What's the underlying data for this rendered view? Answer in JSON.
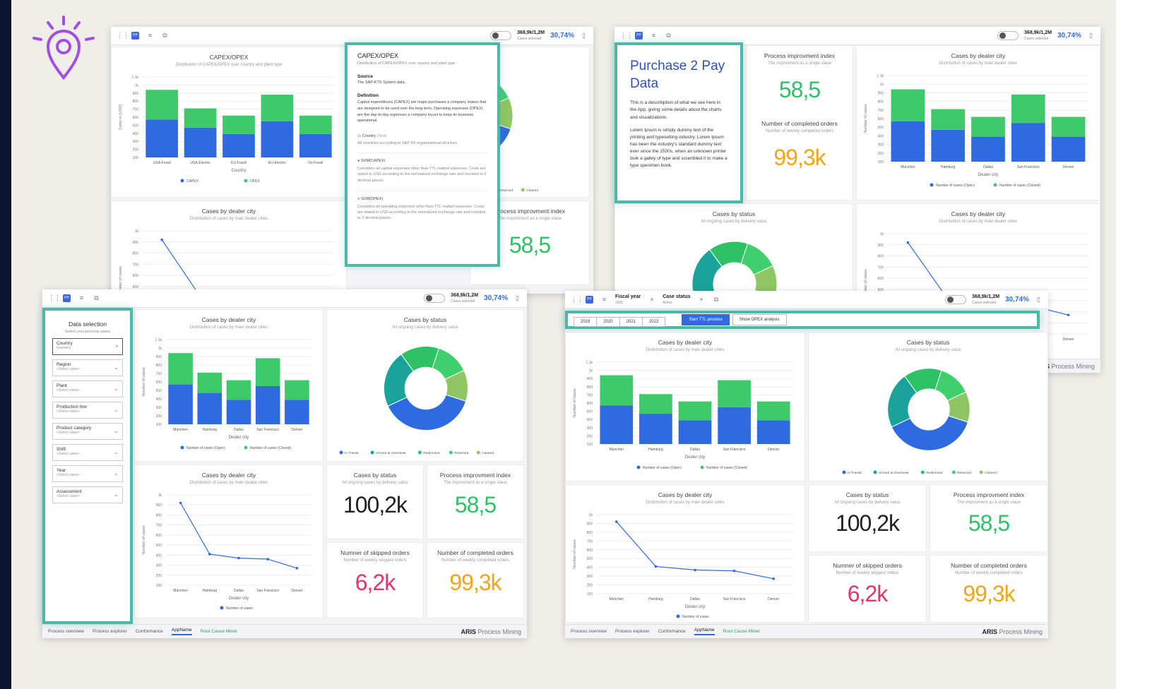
{
  "colors": {
    "blue": "#2f6be0",
    "green": "#3ec96a",
    "teal": "#4bb8a8",
    "orange": "#f2a517",
    "pink": "#e6336b"
  },
  "toolbar": {
    "kpi_value": "368,9k/1,2M",
    "kpi_label": "Cases selected",
    "pct": "30,74%",
    "fiscal_label": "Fiscal year",
    "fiscal_value": "2020",
    "status_label": "Case status",
    "status_value": "Active",
    "pp": "PP"
  },
  "capex": {
    "title": "CAPEX/OPEX",
    "subtitle": "Distribution of CAPEX/OPEX over country and plant type",
    "xlabel": "Country",
    "ylabel": "Costs in (USD)",
    "legend": [
      "CAPEX",
      "OPEX"
    ]
  },
  "tooltip": {
    "title": "CAPEX/OPEX",
    "subtitle": "Distribution of CAPEX/OPEX over country and plant type",
    "source_h": "Source",
    "source": "The SAP-KTS System data.",
    "def_h": "Definition",
    "def": "Capital expenditures (CAPEX) are major purchases a company makes that are designed to be used over the long term. Operating expenses (OPEX) are the day-to-day expenses a company incurs to keep its business operational.",
    "country_h": "Country",
    "country_tag": "(Text)",
    "country": "All countries according to SAP R3 organizational structure.",
    "capex_h": "SUM(CAPEX)",
    "capex": "Considers all capital expenses other than TTL realted expenses. Costs are stated in USD according to the normalized exchange rate and rounded to 2 decimal places.",
    "opex_h": "SUM(OPEX)",
    "opex": "Considers all operating expenses other than TTL realted expenses. Costs are stated in USD according to the normalized exchange rate and rounded to 2 decimal places."
  },
  "info": {
    "title": "Purchase 2 Pay Data",
    "p1": "This is a describption of what we see here in the App, giving some details about the charts and visualizations.",
    "p2": "Lorem Ipsum is simply dummy text of the printing and typesetting industry. Lorem Ipsum has been the industry's standard dummy text ever since the 1500s, when an unknown printer took a galley of type and scrambled it to make a type specimen book."
  },
  "cards": {
    "dealer_title": "Cases by dealer city",
    "dealer_sub": "Distribution of cases by main dealer cities",
    "dealer_x": "Dealer city",
    "dealer_y": "Number of cases",
    "legend_open": "Number of cases (Open)",
    "legend_closed": "Number of cases (Closed)",
    "legend_line": "Number of cases",
    "status_title": "Cases by status",
    "status_sub": "All ongoing cases by delivery satus",
    "status_legend": [
      "In Transit",
      "Arrived at Overseas",
      "Redirected",
      "Returned",
      "Cleared"
    ],
    "pii_title": "Process improvment index",
    "pii_sub": "The improvment as a single vlaue",
    "pii_val": "58,5",
    "cases_val": "100,2k",
    "skip_title": "Numner of skipped orders",
    "skip_sub": "Number of weekly skipped orders",
    "skip_val": "6,2k",
    "comp_title": "Number of completed orders",
    "comp_sub": "Number of weekly completed orders",
    "comp_val": "99,3k"
  },
  "filters": {
    "title": "Data selection",
    "subtitle": "Select your process cases",
    "items": [
      {
        "label": "Country",
        "value": "Germany"
      },
      {
        "label": "Region",
        "value": "<Select value>"
      },
      {
        "label": "Plant",
        "value": "<Select value>"
      },
      {
        "label": "Production line",
        "value": "<Select value>"
      },
      {
        "label": "Product category",
        "value": "<Select value>"
      },
      {
        "label": "Shift",
        "value": "<Select value>"
      },
      {
        "label": "Year",
        "value": "<Select value>"
      },
      {
        "label": "Assessment",
        "value": "<Select value>"
      }
    ]
  },
  "years": [
    "2019",
    "2020",
    "2021",
    "2022"
  ],
  "buttons": {
    "ttl": "Start TTL process",
    "opex": "Show OPEX analysis"
  },
  "tabs": [
    "Process overview",
    "Process explorer",
    "Conformance",
    "AppName",
    "Root Cause Miner"
  ],
  "brand": {
    "bold": "ARIS",
    "rest": " Process Mining"
  },
  "chart_data": [
    {
      "type": "bar",
      "title": "CAPEX/OPEX",
      "xlabel": "Country",
      "ylabel": "Costs in (USD)",
      "categories": [
        "USA-Fossil",
        "USA-Electric",
        "EU-Fossil",
        "EU-Electric",
        "Oz-Fossil"
      ],
      "series": [
        {
          "name": "CAPEX",
          "values": [
            470,
            370,
            290,
            450,
            290
          ]
        },
        {
          "name": "OPEX",
          "values": [
            370,
            240,
            230,
            330,
            230
          ]
        }
      ],
      "yticks": [
        "100",
        "200",
        "300",
        "400",
        "500",
        "600",
        "700",
        "800",
        "900",
        "1k",
        "1.1k"
      ],
      "ylim": [
        100,
        1100
      ]
    },
    {
      "type": "bar",
      "title": "Cases by dealer city",
      "xlabel": "Dealer city",
      "ylabel": "Number of cases",
      "categories": [
        "München",
        "Hamburg",
        "Dallas",
        "San Francisco",
        "Denver"
      ],
      "series": [
        {
          "name": "Number of cases (Open)",
          "values": [
            470,
            370,
            290,
            450,
            290
          ]
        },
        {
          "name": "Number of cases (Closed)",
          "values": [
            370,
            240,
            230,
            330,
            230
          ]
        }
      ],
      "yticks": [
        "100",
        "200",
        "300",
        "400",
        "500",
        "600",
        "700",
        "800",
        "900",
        "1k",
        "1.1k"
      ],
      "ylim": [
        100,
        1100
      ]
    },
    {
      "type": "line",
      "title": "Cases by dealer city",
      "xlabel": "Dealer city",
      "ylabel": "Number of cases",
      "categories": [
        "München",
        "Hamburg",
        "Dallas",
        "San Francisco",
        "Denver"
      ],
      "series": [
        {
          "name": "Number of cases",
          "values": [
            920,
            410,
            370,
            360,
            270
          ]
        }
      ],
      "yticks": [
        "100",
        "200",
        "300",
        "400",
        "500",
        "600",
        "700",
        "800",
        "900",
        "1k"
      ],
      "ylim": [
        100,
        1000
      ]
    },
    {
      "type": "pie",
      "title": "Cases by status",
      "categories": [
        "In Transit",
        "Arrived at Overseas",
        "Redirected",
        "Returned",
        "Cleared"
      ],
      "values": [
        38,
        22,
        15,
        13,
        12
      ]
    }
  ]
}
